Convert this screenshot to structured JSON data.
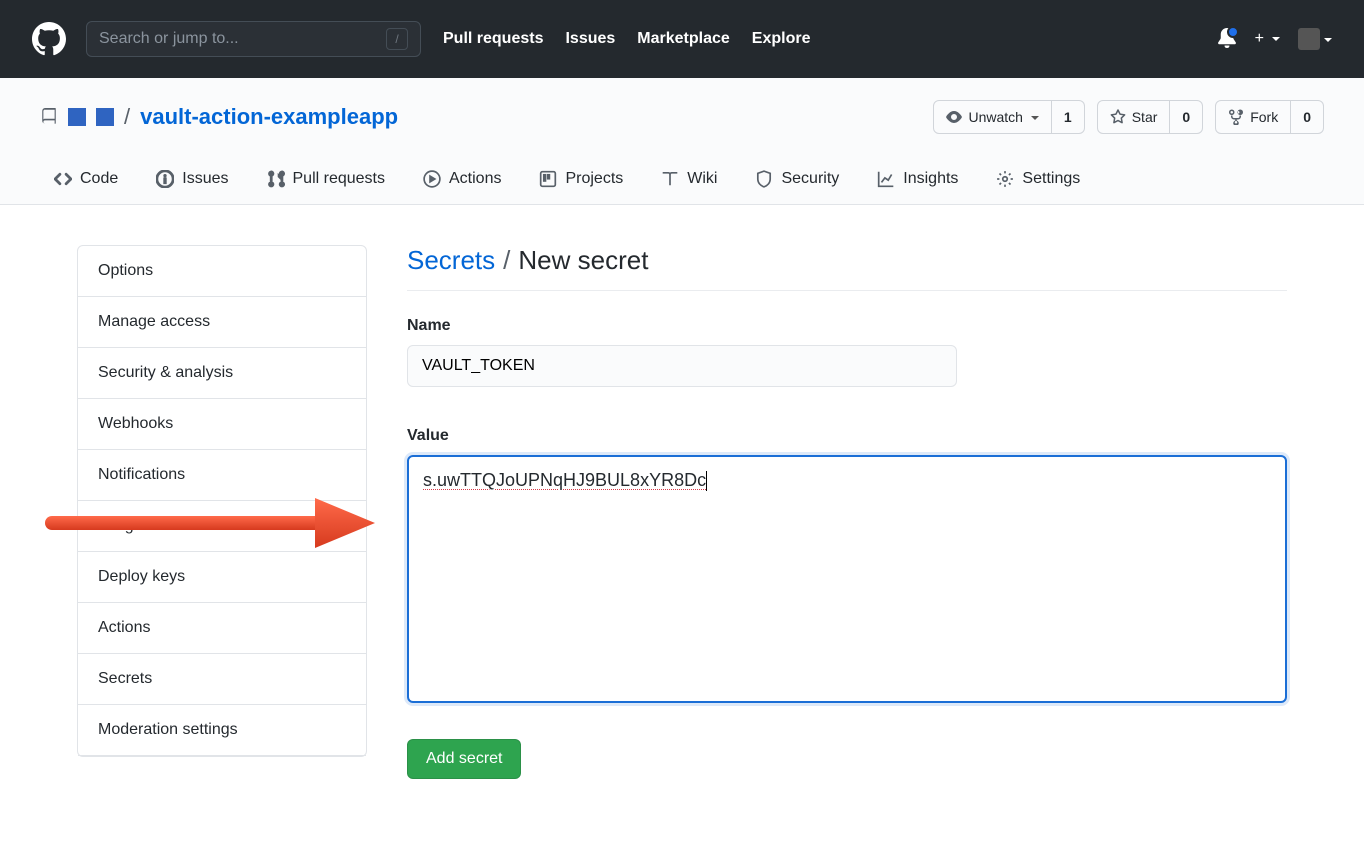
{
  "header": {
    "search_placeholder": "Search or jump to...",
    "slash_hint": "/",
    "nav": [
      "Pull requests",
      "Issues",
      "Marketplace",
      "Explore"
    ]
  },
  "repo": {
    "name": "vault-action-exampleapp",
    "actions": {
      "unwatch": "Unwatch",
      "unwatch_count": "1",
      "star": "Star",
      "star_count": "0",
      "fork": "Fork",
      "fork_count": "0"
    },
    "tabs": [
      "Code",
      "Issues",
      "Pull requests",
      "Actions",
      "Projects",
      "Wiki",
      "Security",
      "Insights",
      "Settings"
    ]
  },
  "sidebar": {
    "items": [
      "Options",
      "Manage access",
      "Security & analysis",
      "Webhooks",
      "Notifications",
      "Integrations",
      "Deploy keys",
      "Actions",
      "Secrets",
      "Moderation settings"
    ]
  },
  "page": {
    "crumb_root": "Secrets",
    "crumb_sep": "/",
    "crumb_current": "New secret",
    "name_label": "Name",
    "name_value": "VAULT_TOKEN",
    "value_label": "Value",
    "value_content": "s.uwTTQJoUPNqHJ9BUL8xYR8Dc",
    "submit": "Add secret"
  }
}
